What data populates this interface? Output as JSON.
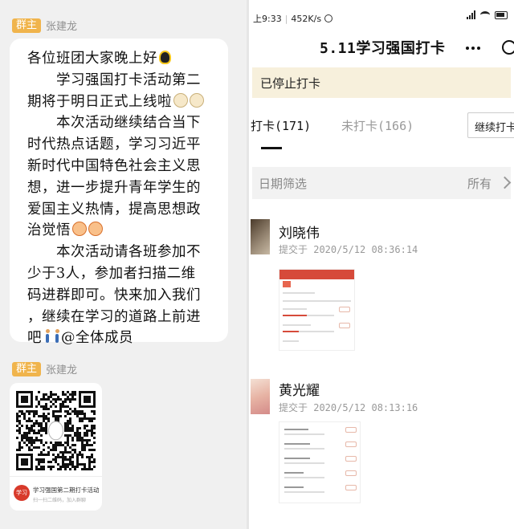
{
  "chat": {
    "badge": "群主",
    "sender": "张建龙",
    "message_lines": [
      "各位班团大家晚上好",
      "　　学习强国打卡活动第二",
      "期将于明日正式上线啦",
      "　　本次活动继续结合当下",
      "时代热点话题，学习习近平",
      "新时代中国特色社会主义思",
      "想，进一步提升青年学生的",
      "爱国主义热情，提高思想政",
      "治觉悟",
      "　　本次活动请各班参加不",
      "少于3人，参加者扫描二维",
      "码进群即可。快来加入我们",
      "，继续在学习的道路上前进",
      "吧",
      "@全体成员"
    ],
    "card": {
      "logo": "学习",
      "title": "学习强国第二期打卡活动",
      "subtitle": "扫一扫二维码，加入群聊"
    }
  },
  "phone": {
    "status": {
      "time": "上9:33",
      "speed": "452K/s"
    },
    "nav_title": "5.11学习强国打卡",
    "notice": "已停止打卡",
    "tabs": {
      "done": "打卡(171)",
      "not_done": "未打卡(166)"
    },
    "continue_button": "继续打卡",
    "filter": {
      "label": "日期筛选",
      "value": "所有"
    },
    "records": [
      {
        "name": "刘晓伟",
        "time": "提交于 2020/5/12 08:36:14"
      },
      {
        "name": "黄光耀",
        "time": "提交于 2020/5/12 08:13:16"
      }
    ]
  }
}
